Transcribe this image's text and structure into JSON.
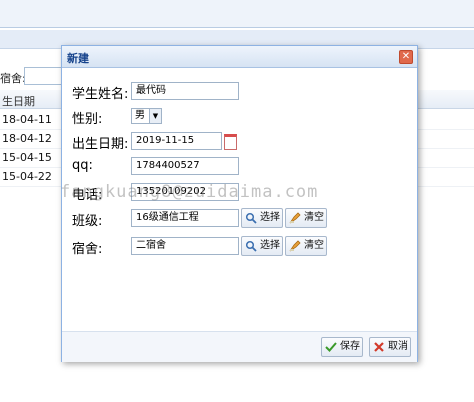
{
  "background": {
    "filter_label": "宿舍:",
    "column_header": "生日期",
    "rows": [
      "18-04-11",
      "18-04-12",
      "15-04-15",
      "15-04-22"
    ]
  },
  "dialog": {
    "title": "新建",
    "close_symbol": "✕",
    "fields": {
      "name_label": "学生姓名:",
      "name_value": "最代码",
      "gender_label": "性别:",
      "gender_value": "男",
      "birth_label": "出生日期:",
      "birth_value": "2019-11-15",
      "qq_label": "qq:",
      "qq_value": "1784400527",
      "phone_label": "电话:",
      "phone_value": "13520109202",
      "class_label": "班级:",
      "class_value": "16级通信工程",
      "dorm_label": "宿舍:",
      "dorm_value": "二宿舍"
    },
    "buttons": {
      "select": "选择",
      "clear": "清空",
      "save": "保存",
      "cancel": "取消"
    }
  },
  "watermark": "fangkuang8@zuidaima.com",
  "colors": {
    "title_text": "#15428b",
    "dialog_border": "#8db2e3"
  }
}
